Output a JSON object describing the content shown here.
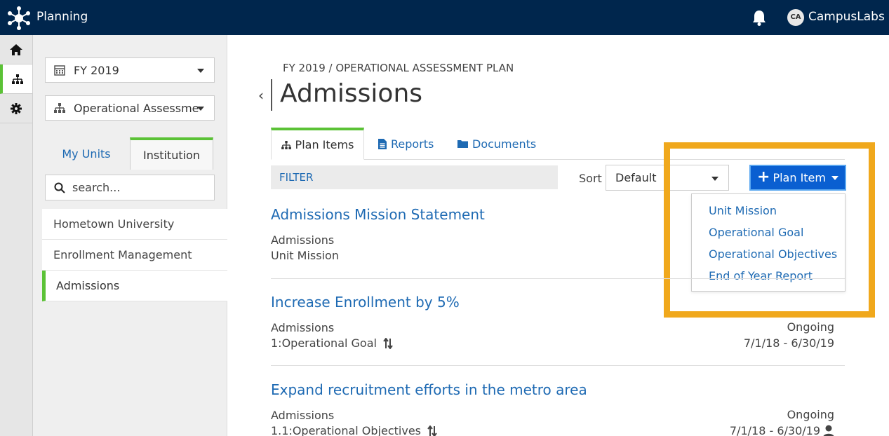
{
  "app": {
    "title": "Planning",
    "user_initials": "CA",
    "user_name": "CampusLabs"
  },
  "rail": {
    "items": [
      "home-icon",
      "org-chart-icon",
      "gear-icon"
    ],
    "active": "org-chart-icon"
  },
  "left_panel": {
    "year_select": "FY 2019",
    "plan_select": "Operational Assessmer",
    "unit_tabs": {
      "my_units": "My Units",
      "institution": "Institution"
    },
    "search_placeholder": "search...",
    "units": [
      "Hometown University",
      "Enrollment Management",
      "Admissions"
    ],
    "selected_unit": "Admissions"
  },
  "main": {
    "breadcrumb": "FY 2019 / OPERATIONAL ASSESSMENT PLAN",
    "title": "Admissions",
    "tabs": [
      "Plan Items",
      "Reports",
      "Documents"
    ],
    "filter_label": "FILTER",
    "sort_label": "Sort",
    "sort_value": "Default",
    "plan_item_button": "Plan Item",
    "plan_item_menu": [
      "Unit Mission",
      "Operational Goal",
      "Operational Objectives",
      "End of Year Report"
    ],
    "items": [
      {
        "title": "Admissions Mission Statement",
        "unit": "Admissions",
        "type": "Unit Mission",
        "status": "",
        "dates": ""
      },
      {
        "title": "Increase Enrollment by 5%",
        "unit": "Admissions",
        "type": "1:Operational Goal",
        "status": "Ongoing",
        "dates": "7/1/18 - 6/30/19"
      },
      {
        "title": "Expand recruitment efforts in the metro area",
        "unit": "Admissions",
        "type": "1.1:Operational Objectives",
        "status": "Ongoing",
        "dates": "7/1/18 - 6/30/19"
      }
    ]
  },
  "colors": {
    "topbar": "#00264d",
    "accent_green": "#5bc236",
    "link_blue": "#1e6ab3",
    "button_blue": "#0a5fd1",
    "highlight_orange": "#f0a81c"
  }
}
